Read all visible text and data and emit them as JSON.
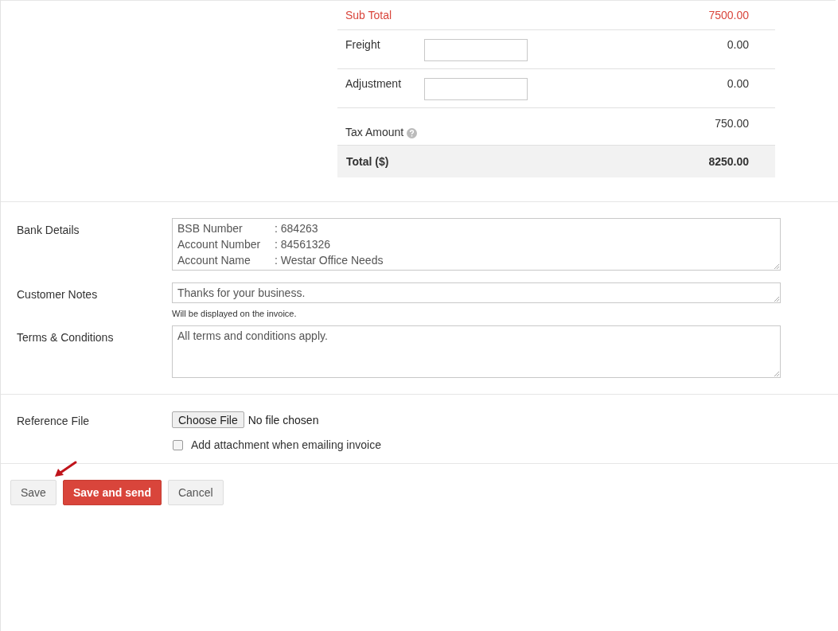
{
  "totals": [
    {
      "kind": "subtotal",
      "label": "Sub Total",
      "amount": "7500.00"
    },
    {
      "kind": "input",
      "label": "Freight",
      "amount": "0.00"
    },
    {
      "kind": "input",
      "label": "Adjustment",
      "amount": "0.00"
    },
    {
      "kind": "help",
      "label": "Tax Amount",
      "amount": "750.00"
    },
    {
      "kind": "total",
      "label": "Total ($)",
      "amount": "8250.00"
    }
  ],
  "bank_details": {
    "label": "Bank Details",
    "lines": [
      {
        "label": "BSB Number",
        "value": ": 684263"
      },
      {
        "label": "Account Number",
        "value": ": 84561326"
      },
      {
        "label": "Account Name",
        "value": ": Westar Office Needs"
      }
    ]
  },
  "customer_notes": {
    "label": "Customer Notes",
    "value": "Thanks for your business.",
    "hint": "Will be displayed on the invoice."
  },
  "terms": {
    "label": "Terms & Conditions",
    "value": "All terms and conditions apply."
  },
  "reference_file": {
    "label": "Reference File",
    "button": "Choose File",
    "status": "No file chosen",
    "attachment": {
      "label": "Add attachment when emailing invoice",
      "checked": false
    }
  },
  "buttons": [
    {
      "kind": "default",
      "label": "Save"
    },
    {
      "kind": "primary",
      "label": "Save and send"
    },
    {
      "kind": "default",
      "label": "Cancel"
    }
  ]
}
